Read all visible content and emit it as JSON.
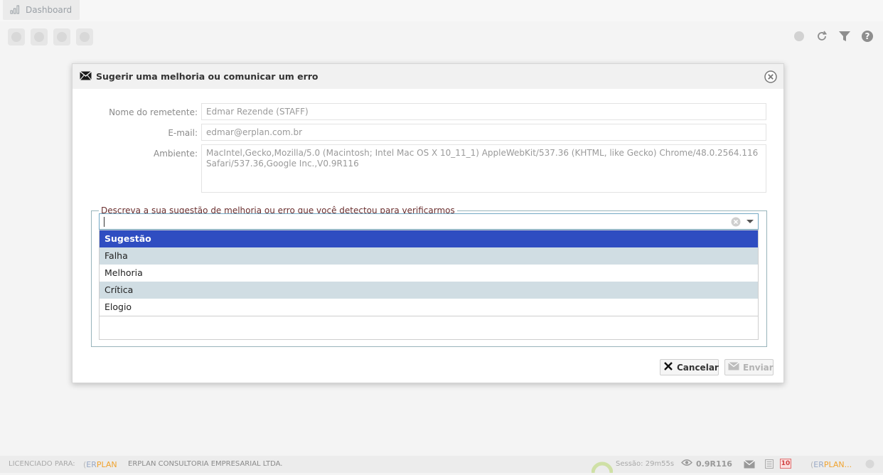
{
  "tabs": {
    "dashboard": "Dashboard"
  },
  "modal": {
    "title": "Sugerir uma melhoria ou comunicar um erro",
    "sender_label": "Nome do remetente:",
    "sender_value": "Edmar Rezende (STAFF)",
    "email_label": "E-mail:",
    "email_value": "edmar@erplan.com.br",
    "env_label": "Ambiente:",
    "env_value": "MacIntel,Gecko,Mozilla/5.0 (Macintosh; Intel Mac OS X 10_11_1) AppleWebKit/537.36 (KHTML, like Gecko) Chrome/48.0.2564.116 Safari/537.36,Google Inc.,V0.9R116",
    "fieldset_legend": "Descreva a sua sugestão de melhoria ou erro que você detectou para verificarmos",
    "combo_value": "",
    "options": [
      "Sugestão",
      "Falha",
      "Melhoria",
      "Crítica",
      "Elogio"
    ],
    "cancel_label": "Cancelar",
    "send_label": "Enviar"
  },
  "statusbar": {
    "licensed_label": "LICENCIADO PARA:",
    "logo_er": "ER",
    "logo_plan": "PLAN",
    "company": "ERPLAN CONSULTORIA EMPRESARIAL LTDA.",
    "session": "Sessão: 29m55s",
    "version": "0.9R116",
    "badge": "10",
    "logo_right_er": "ER",
    "logo_right_plan": "PLAN..."
  },
  "colors": {
    "accent": "#2f4dc1",
    "row_alt": "#d0dde3",
    "fieldset_border": "#98b4bb",
    "logo_orange": "#f0a32f"
  }
}
